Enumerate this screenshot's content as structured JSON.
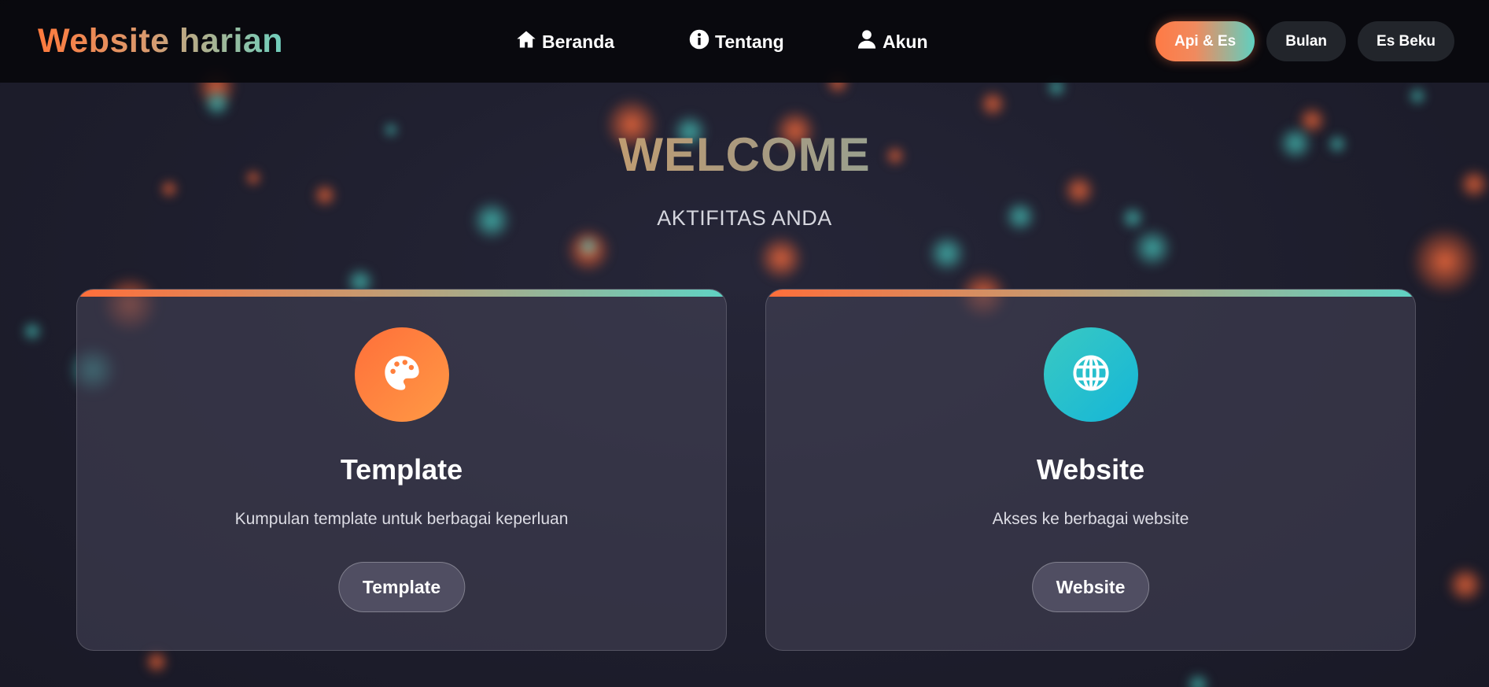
{
  "header": {
    "brand": "Website harian",
    "nav": [
      {
        "label": "Beranda",
        "icon": "home-icon"
      },
      {
        "label": "Tentang",
        "icon": "info-icon"
      },
      {
        "label": "Akun",
        "icon": "user-icon"
      }
    ],
    "themes": [
      {
        "label": "Api & Es",
        "active": true
      },
      {
        "label": "Bulan",
        "active": false
      },
      {
        "label": "Es Beku",
        "active": false
      }
    ]
  },
  "hero": {
    "title": "WELCOME",
    "subtitle": "AKTIFITAS ANDA"
  },
  "cards": [
    {
      "icon": "palette-icon",
      "title": "Template",
      "description": "Kumpulan template untuk berbagai keperluan",
      "button": "Template",
      "color": "#ff7a3a"
    },
    {
      "icon": "globe-icon",
      "title": "Website",
      "description": "Akses ke berbagai website",
      "button": "Website",
      "color": "#1fbfd0"
    }
  ],
  "colors": {
    "accent_orange": "#ff7a3d",
    "accent_teal": "#5fd3c4",
    "background": "#1e1e2d"
  }
}
